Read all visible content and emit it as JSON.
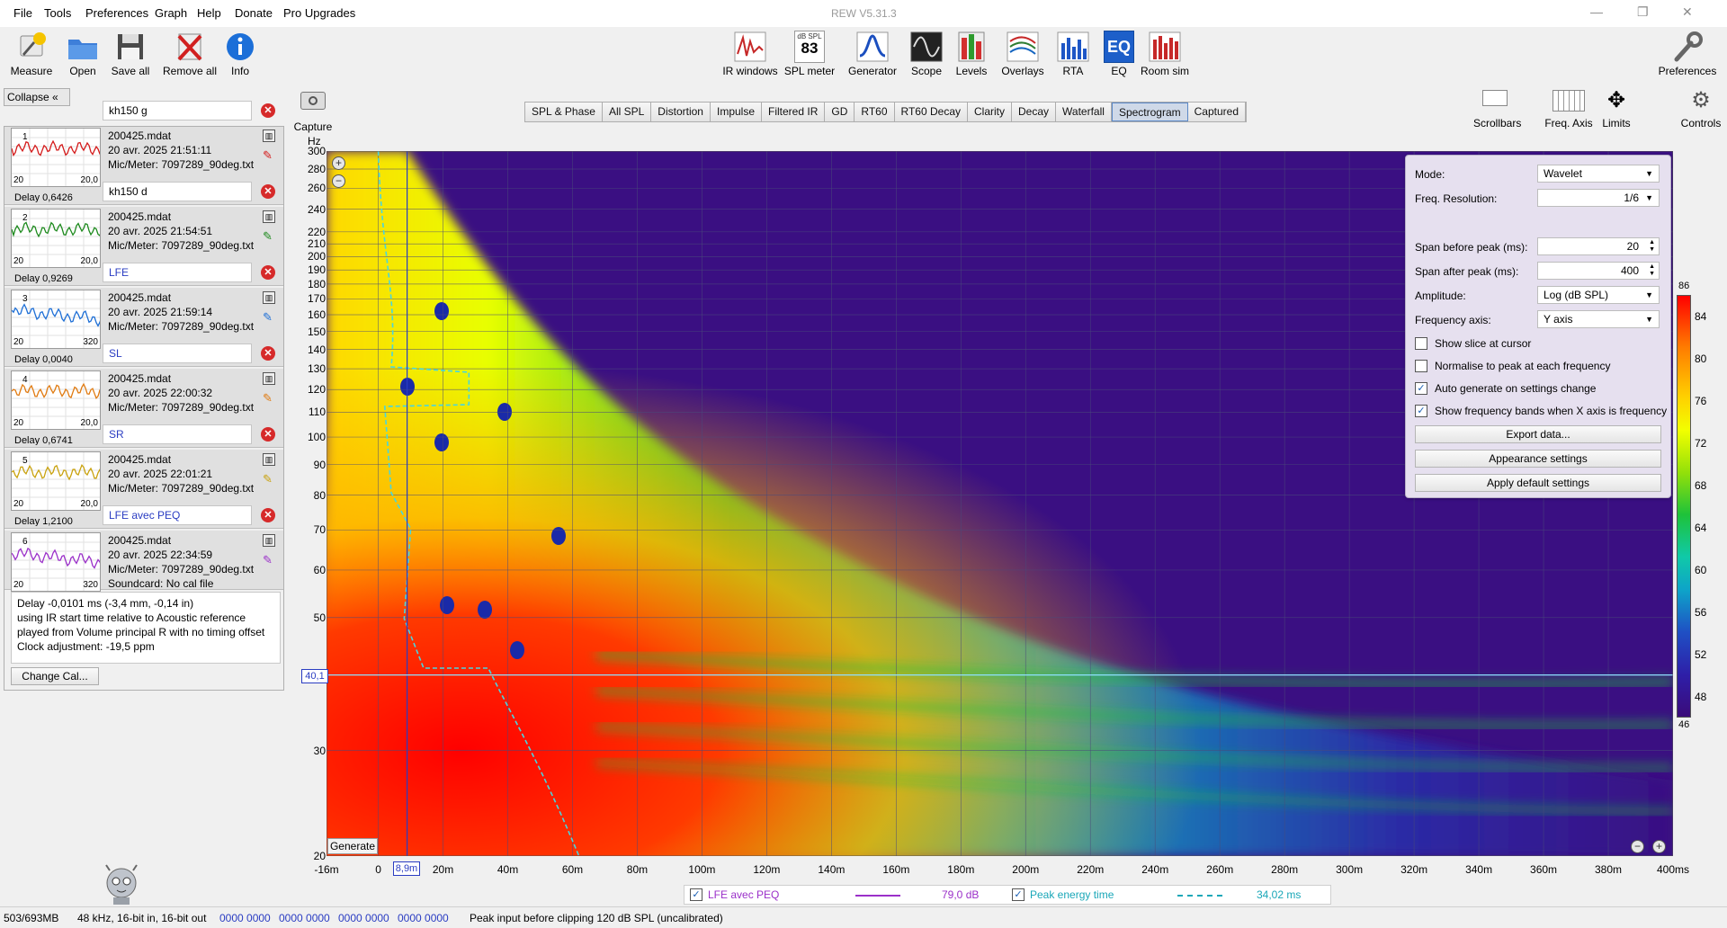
{
  "menu": {
    "items": [
      "File",
      "Tools",
      "Preferences",
      "Graph",
      "Help",
      "Donate",
      "Pro Upgrades"
    ],
    "title": "REW V5.31.3"
  },
  "toolbar_left": [
    {
      "label": "Measure",
      "icon": "microphone-icon"
    },
    {
      "label": "Open",
      "icon": "folder-icon"
    },
    {
      "label": "Save all",
      "icon": "floppy-disk-icon"
    },
    {
      "label": "Remove all",
      "icon": "remove-all-icon"
    },
    {
      "label": "Info",
      "icon": "info-icon"
    }
  ],
  "toolbar_center": [
    {
      "label": "IR windows",
      "icon": "ir-windows-icon"
    },
    {
      "label": "SPL meter",
      "icon": "spl-meter-icon",
      "badge_top": "dB SPL",
      "badge_value": "83"
    },
    {
      "label": "Generator",
      "icon": "generator-icon"
    },
    {
      "label": "Scope",
      "icon": "scope-icon"
    },
    {
      "label": "Levels",
      "icon": "levels-icon"
    },
    {
      "label": "Overlays",
      "icon": "overlays-icon"
    },
    {
      "label": "RTA",
      "icon": "rta-icon"
    },
    {
      "label": "EQ",
      "icon": "eq-icon",
      "badge_value": "EQ"
    },
    {
      "label": "Room sim",
      "icon": "room-sim-icon"
    }
  ],
  "toolbar_right": {
    "preferences": "Preferences",
    "scrollbars": "Scrollbars",
    "freq_axis": "Freq. Axis",
    "limits": "Limits",
    "controls": "Controls",
    "capture": "Capture"
  },
  "tabs": [
    "SPL & Phase",
    "All SPL",
    "Distortion",
    "Impulse",
    "Filtered IR",
    "GD",
    "RT60",
    "RT60 Decay",
    "Clarity",
    "Decay",
    "Waterfall",
    "Spectrogram",
    "Captured"
  ],
  "active_tab": "Spectrogram",
  "panel": {
    "collapse": "Collapse",
    "change_cal": "Change Cal...",
    "measurements": [
      {
        "num": "1",
        "name": "kh150 g",
        "file": "200425.mdat",
        "date": "20 avr. 2025 21:51:11",
        "mic": "Mic/Meter: 7097289_90deg.txt",
        "delay": "Delay 0,6426",
        "t_lo": "20",
        "t_hi": "20,0",
        "color": "#d41a1a"
      },
      {
        "num": "2",
        "name": "kh150 d",
        "file": "200425.mdat",
        "date": "20 avr. 2025 21:54:51",
        "mic": "Mic/Meter: 7097289_90deg.txt",
        "delay": "Delay 0,9269",
        "t_lo": "20",
        "t_hi": "20,0",
        "color": "#1d8a1d"
      },
      {
        "num": "3",
        "name": "LFE",
        "file": "200425.mdat",
        "date": "20 avr. 2025 21:59:14",
        "mic": "Mic/Meter: 7097289_90deg.txt",
        "delay": "Delay 0,0040",
        "t_lo": "20",
        "t_hi": "320",
        "color": "#1e6fd6"
      },
      {
        "num": "4",
        "name": "SL",
        "file": "200425.mdat",
        "date": "20 avr. 2025 22:00:32",
        "mic": "Mic/Meter: 7097289_90deg.txt",
        "delay": "Delay 0,6741",
        "t_lo": "20",
        "t_hi": "20,0",
        "color": "#e07a10"
      },
      {
        "num": "5",
        "name": "SR",
        "file": "200425.mdat",
        "date": "20 avr. 2025 22:01:21",
        "mic": "Mic/Meter: 7097289_90deg.txt",
        "delay": "Delay 1,2100",
        "t_lo": "20",
        "t_hi": "20,0",
        "color": "#c9a20e"
      },
      {
        "num": "6",
        "name": "LFE avec PEQ",
        "file": "200425.mdat",
        "date": "20 avr. 2025 22:34:59",
        "mic": "Mic/Meter: 7097289_90deg.txt",
        "soundcard": "Soundcard: No cal file",
        "t_lo": "20",
        "t_hi": "320",
        "color": "#9b30c9"
      }
    ],
    "info": [
      "Delay -0,0101 ms (-3,4 mm, -0,14 in)",
      "using IR start time relative to Acoustic reference",
      "played from Volume principal R with no timing offset",
      "Clock adjustment: -19,5 ppm"
    ]
  },
  "settings": {
    "mode_label": "Mode:",
    "mode": "Wavelet",
    "freq_res_label": "Freq. Resolution:",
    "freq_res": "1/6",
    "span_before_label": "Span before peak (ms):",
    "span_before": "20",
    "span_after_label": "Span after peak (ms):",
    "span_after": "400",
    "amplitude_label": "Amplitude:",
    "amplitude": "Log (dB SPL)",
    "freq_axis_label": "Frequency axis:",
    "freq_axis": "Y axis",
    "checks": [
      {
        "label": "Show slice at cursor",
        "checked": false
      },
      {
        "label": "Normalise to peak at each frequency",
        "checked": false
      },
      {
        "label": "Auto generate on settings change",
        "checked": true
      },
      {
        "label": "Show frequency bands when X axis is frequency",
        "checked": true
      }
    ],
    "export": "Export data...",
    "appearance": "Appearance settings",
    "defaults": "Apply default settings"
  },
  "chart_data": {
    "type": "heatmap",
    "ylabel": "Hz",
    "y_ticks": [
      "300",
      "280",
      "260",
      "240",
      "220",
      "210",
      "200",
      "190",
      "180",
      "170",
      "160",
      "150",
      "140",
      "130",
      "120",
      "110",
      "100",
      "90",
      "80",
      "70",
      "60",
      "50",
      "40,1",
      "30",
      "20"
    ],
    "x_ticks": [
      "-16m",
      "0",
      "8,9m",
      "20m",
      "40m",
      "60m",
      "80m",
      "100m",
      "120m",
      "140m",
      "160m",
      "180m",
      "200m",
      "220m",
      "240m",
      "260m",
      "280m",
      "300m",
      "320m",
      "340m",
      "360m",
      "380m",
      "400ms"
    ],
    "xlim": [
      -16,
      400
    ],
    "ylim": [
      20,
      300
    ],
    "yscale": "log",
    "colorbar": {
      "min": "46",
      "max": "86",
      "ticks": [
        "86",
        "84",
        "80",
        "76",
        "72",
        "68",
        "64",
        "60",
        "56",
        "52",
        "48",
        "46"
      ]
    },
    "cursor": {
      "x": "8,9m",
      "y": "40,1"
    },
    "generate": "Generate",
    "legend": {
      "series_name": "LFE avec PEQ",
      "series_value": "79,0 dB",
      "peak_name": "Peak energy time",
      "peak_value": "34,02 ms"
    }
  },
  "status": {
    "memory": "503/693MB",
    "format": "48 kHz, 16-bit in, 16-bit out",
    "levels": [
      "0000 0000",
      "0000 0000",
      "0000 0000",
      "0000 0000"
    ],
    "peak_input": "Peak input before clipping 120 dB SPL (uncalibrated)"
  }
}
